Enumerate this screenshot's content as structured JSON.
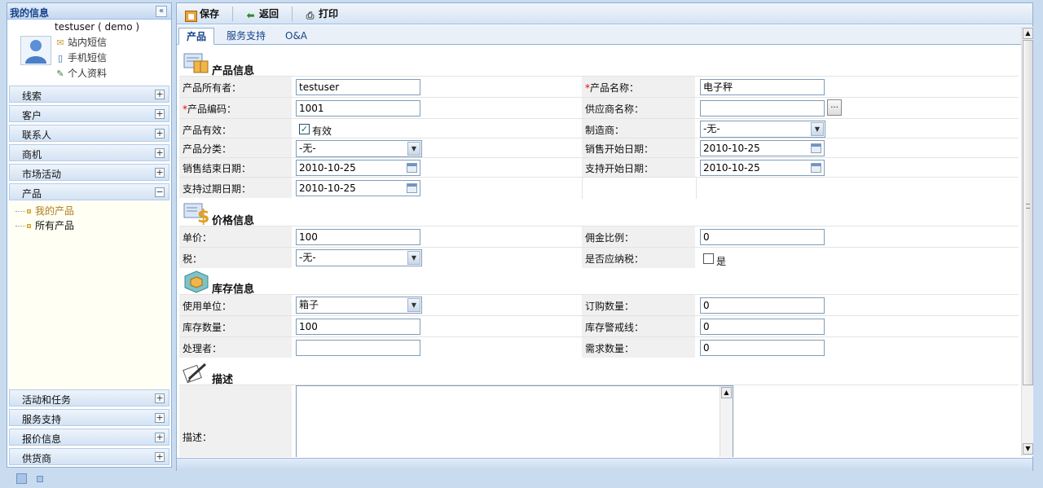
{
  "sidebar": {
    "title": "我的信息",
    "collapse_icon": "double-chevron-left-icon",
    "user": {
      "name": "testuser ( demo )",
      "links": [
        "站内短信",
        "手机短信",
        "个人资料"
      ]
    },
    "sections_top": [
      "线索",
      "客户",
      "联系人",
      "商机",
      "市场活动"
    ],
    "open_section": "产品",
    "tree_items": [
      "我的产品",
      "所有产品"
    ],
    "sections_bottom": [
      "活动和任务",
      "服务支持",
      "报价信息",
      "供货商"
    ],
    "expand_symbol": "+",
    "collapse_symbol": "−"
  },
  "toolbar": {
    "save_label": "保存",
    "back_label": "返回",
    "print_label": "打印"
  },
  "tabs": [
    "产品",
    "服务支持",
    "O&A"
  ],
  "sections": {
    "product_info": "产品信息",
    "price_info": "价格信息",
    "stock_info": "库存信息",
    "description": "描述"
  },
  "form": {
    "owner_label": "产品所有者：",
    "owner_value": "testuser",
    "name_label": "产品名称：",
    "name_value": "电子秤",
    "code_label": "产品编码：",
    "code_value": "1001",
    "supplier_label": "供应商名称：",
    "supplier_value": "",
    "supplier_btn": "...",
    "active_label": "产品有效：",
    "active_check_label": "有效",
    "manufacturer_label": "制造商：",
    "manufacturer_value": "-无-",
    "category_label": "产品分类：",
    "category_value": "-无-",
    "sales_start_label": "销售开始日期：",
    "sales_start_value": "2010-10-25",
    "sales_end_label": "销售结束日期：",
    "sales_end_value": "2010-10-25",
    "support_start_label": "支持开始日期：",
    "support_start_value": "2010-10-25",
    "support_expire_label": "支持过期日期：",
    "support_expire_value": "2010-10-25",
    "price_label": "单价：",
    "price_value": "100",
    "commission_label": "佣金比例：",
    "commission_value": "0",
    "tax_label": "税：",
    "tax_value": "-无-",
    "taxable_label": "是否应纳税：",
    "taxable_check_label": "是",
    "unit_label": "使用单位：",
    "unit_value": "箱子",
    "order_qty_label": "订购数量：",
    "order_qty_value": "0",
    "stock_qty_label": "库存数量：",
    "stock_qty_value": "100",
    "stock_alert_label": "库存警戒线：",
    "stock_alert_value": "0",
    "handler_label": "处理者：",
    "handler_value": "",
    "demand_qty_label": "需求数量：",
    "demand_qty_value": "0",
    "desc_label": "描述：",
    "required_mark": "*"
  },
  "colors": {
    "header_text": "#15428b",
    "border": "#8eb0d6",
    "background": "#c9dbef",
    "required": "#ee0000"
  }
}
